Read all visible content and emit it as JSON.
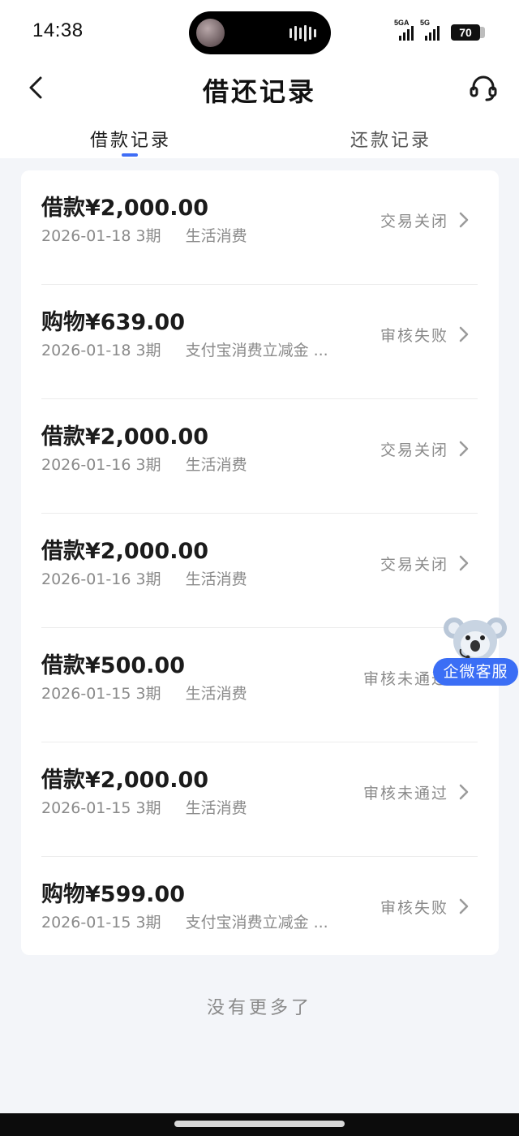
{
  "status_bar": {
    "time": "14:38",
    "signal1_label": "5GA",
    "signal2_label": "5G",
    "battery": "70"
  },
  "header": {
    "title": "借还记录"
  },
  "tabs": [
    {
      "label": "借款记录",
      "active": true
    },
    {
      "label": "还款记录",
      "active": false
    }
  ],
  "records": [
    {
      "title": "借款¥2,000.00",
      "date": "2026-01-18",
      "period": "3期",
      "purpose": "生活消费",
      "status": "交易关闭"
    },
    {
      "title": "购物¥639.00",
      "date": "2026-01-18",
      "period": "3期",
      "purpose": "支付宝消费立减金 ...",
      "status": "审核失败"
    },
    {
      "title": "借款¥2,000.00",
      "date": "2026-01-16",
      "period": "3期",
      "purpose": "生活消费",
      "status": "交易关闭"
    },
    {
      "title": "借款¥2,000.00",
      "date": "2026-01-16",
      "period": "3期",
      "purpose": "生活消费",
      "status": "交易关闭"
    },
    {
      "title": "借款¥500.00",
      "date": "2026-01-15",
      "period": "3期",
      "purpose": "生活消费",
      "status": "审核未通过"
    },
    {
      "title": "借款¥2,000.00",
      "date": "2026-01-15",
      "period": "3期",
      "purpose": "生活消费",
      "status": "审核未通过"
    },
    {
      "title": "购物¥599.00",
      "date": "2026-01-15",
      "period": "3期",
      "purpose": "支付宝消费立减金 ...",
      "status": "审核失败"
    }
  ],
  "footer": {
    "no_more": "没有更多了"
  },
  "float_service": {
    "label": "企微客服"
  },
  "colors": {
    "accent": "#3f6df6",
    "float_button": "#3b6ef5",
    "page_bg": "#f3f5f9",
    "muted_text": "#8a8a8a"
  }
}
